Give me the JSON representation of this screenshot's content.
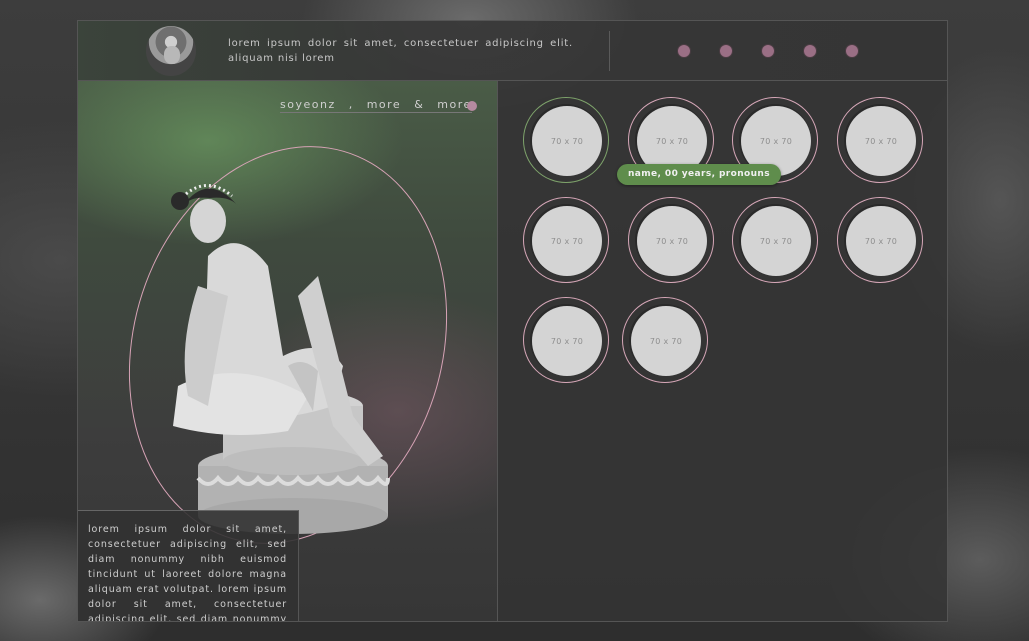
{
  "header": {
    "description": "lorem ipsum dolor sit amet, consectetuer adipiscing elit. aliquam nisi lorem",
    "nav_dots": 5
  },
  "sidebar": {
    "nav_label": "soyeonz  ,  more  &  more"
  },
  "bio": {
    "text": "lorem ipsum dolor sit amet, consectetuer adipiscing elit, sed diam nonummy nibh euismod tincidunt ut laoreet dolore magna aliquam erat volutpat. lorem ipsum dolor sit amet, consectetuer adipiscing elit, sed diam nonummy nibh euismod tincidunt ut laoreet dolore magna aliquam erat volutpat."
  },
  "gallery": {
    "items": [
      {
        "placeholder": "70 x 70",
        "active": true
      },
      {
        "placeholder": "70 x 70",
        "active": false
      },
      {
        "placeholder": "70 x 70",
        "active": false
      },
      {
        "placeholder": "70 x 70",
        "active": false
      },
      {
        "placeholder": "70 x 70",
        "active": false
      },
      {
        "placeholder": "70 x 70",
        "active": false
      },
      {
        "placeholder": "70 x 70",
        "active": false
      },
      {
        "placeholder": "70 x 70",
        "active": false
      },
      {
        "placeholder": "70 x 70",
        "active": false
      },
      {
        "placeholder": "70 x 70",
        "active": false
      }
    ],
    "tooltip": "name, 00 years, pronouns"
  },
  "colors": {
    "accent_pink": "#d6a7b8",
    "accent_green": "#5f8d4c",
    "dot": "#9a6f85"
  }
}
